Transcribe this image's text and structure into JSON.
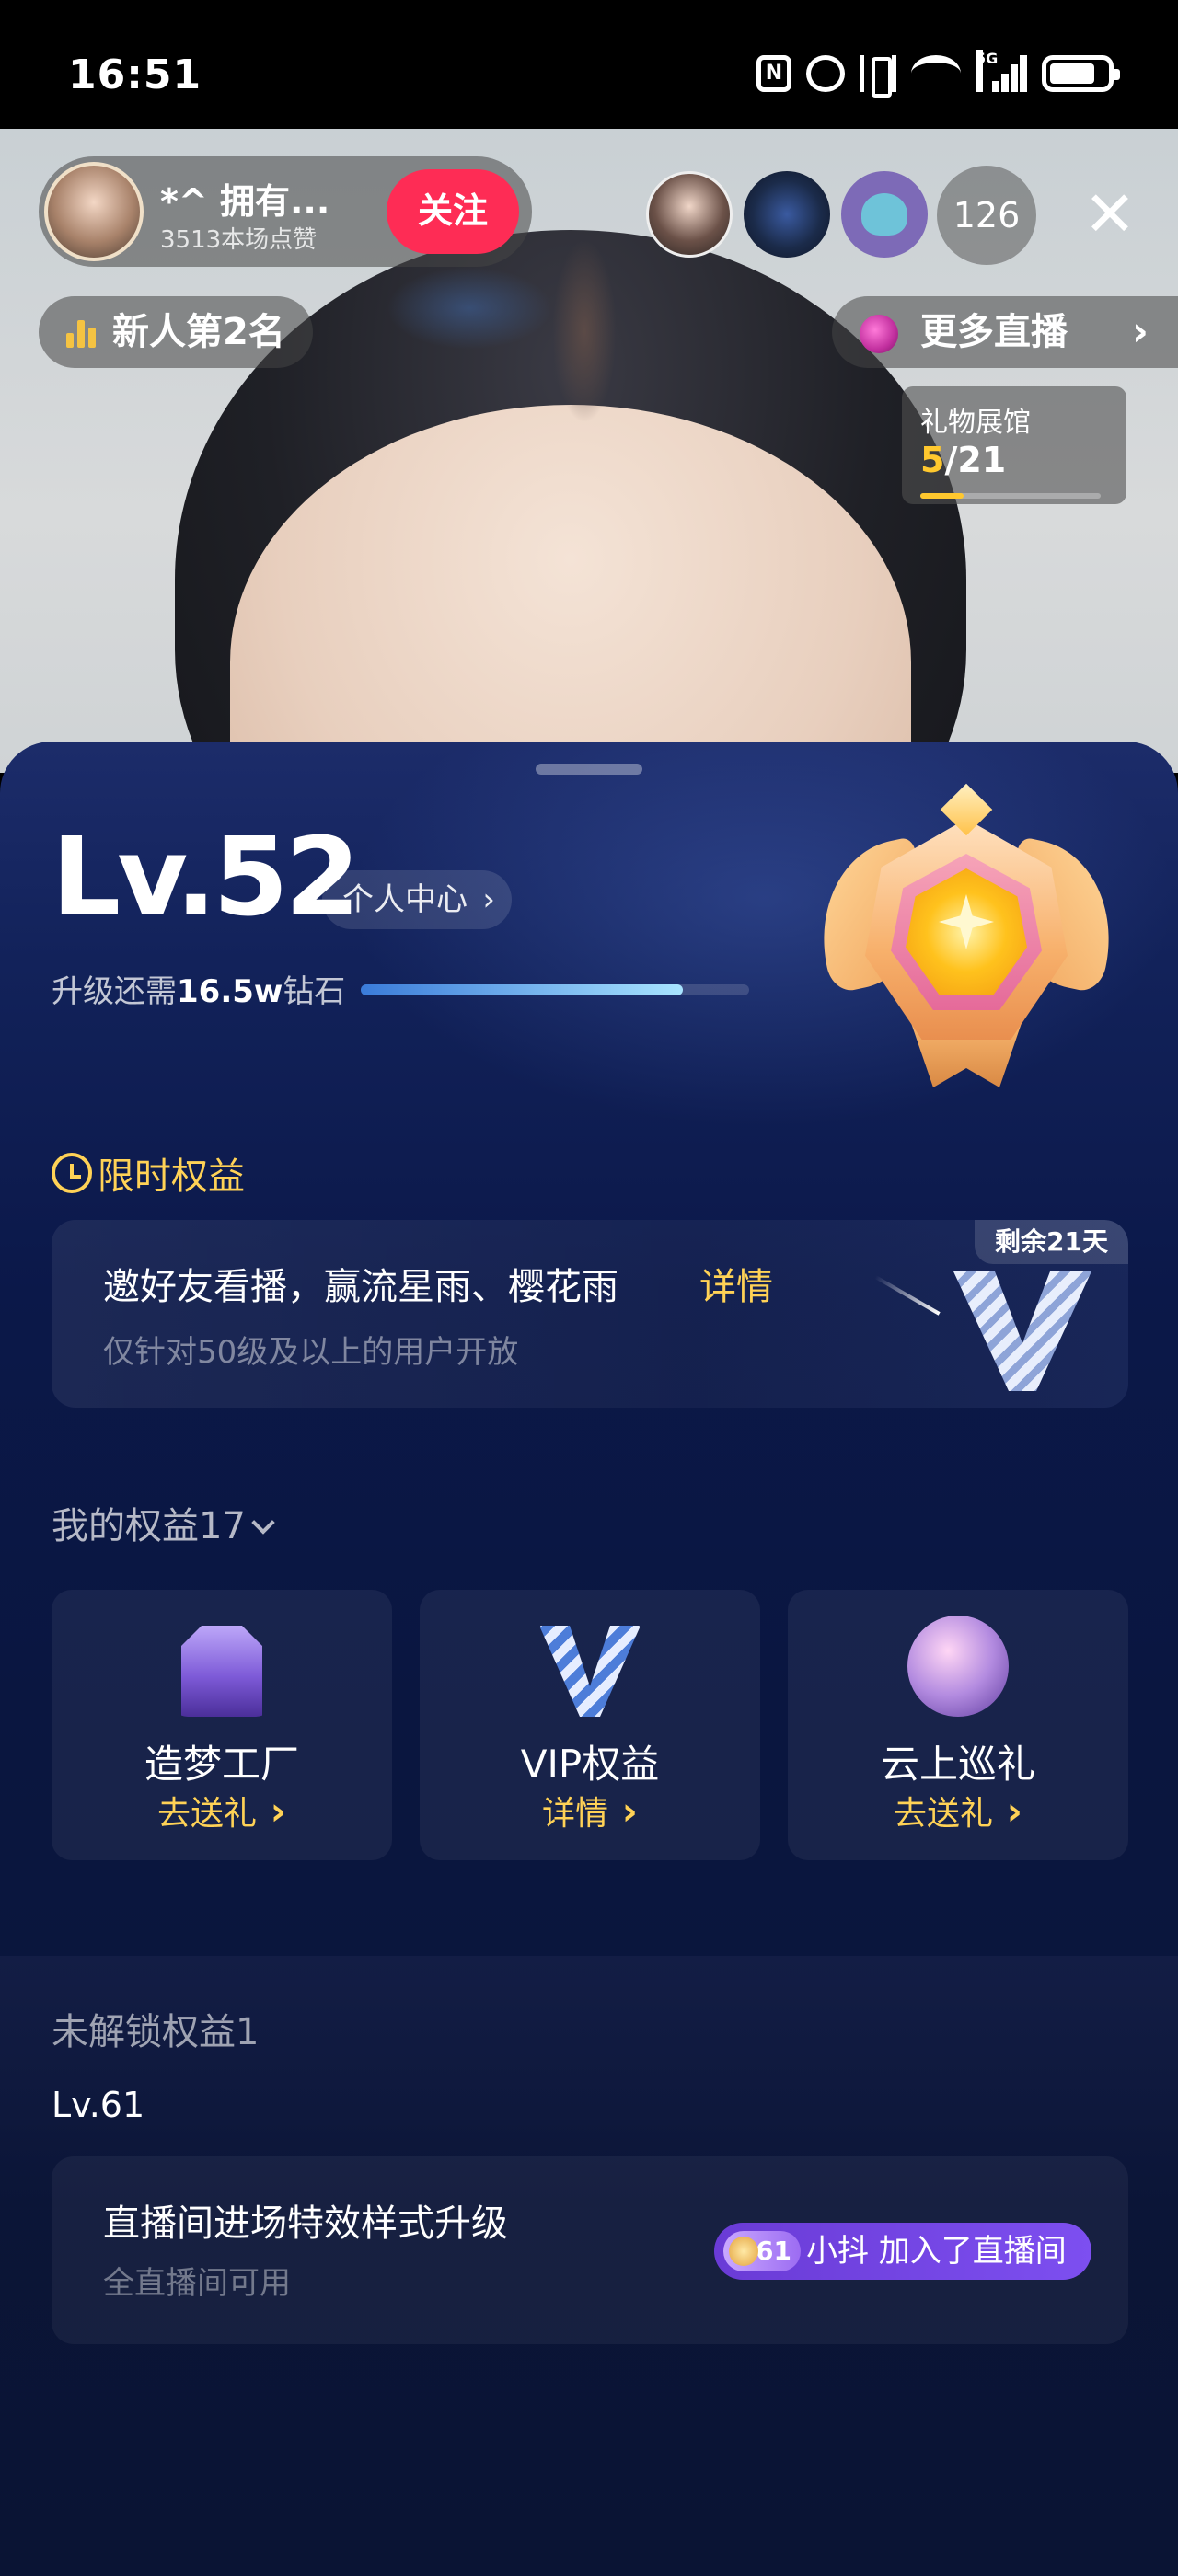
{
  "status_bar": {
    "time": "16:51",
    "network": "5G",
    "icons": [
      "nfc-icon",
      "alarm-icon",
      "vibrate-icon",
      "wifi-icon",
      "signal-icon",
      "battery-icon"
    ]
  },
  "live": {
    "host": {
      "name": "*^ 拥有...",
      "likes": "3513本场点赞",
      "follow_label": "关注"
    },
    "viewer_count": "126",
    "close_label": "✕",
    "rank_label": "新人第2名",
    "more_live_label": "更多直播",
    "more_live_chevron": "›",
    "gift_hall": {
      "title": "礼物展馆",
      "current": "5",
      "total": "/21",
      "progress_fraction": 0.238
    }
  },
  "level_panel": {
    "level": "Lv.52",
    "personal_center": "个人中心",
    "personal_center_chevron": "›",
    "upgrade_prefix": "升级还需",
    "upgrade_amount": "16.5w",
    "upgrade_suffix": "钻石",
    "progress_fraction": 0.83,
    "limited_title": "限时权益",
    "promo": {
      "title": "邀好友看播，赢流星雨、樱花雨",
      "detail": "详情",
      "subtitle": "仅针对50级及以上的用户开放",
      "remaining": "剩余21天"
    },
    "my_rights_title": "我的权益17",
    "rights": [
      {
        "name": "造梦工厂",
        "action": "去送礼",
        "icon": "dream-factory-icon"
      },
      {
        "name": "VIP权益",
        "action": "详情",
        "icon": "vip-icon"
      },
      {
        "name": "云上巡礼",
        "action": "去送礼",
        "icon": "cloud-tour-icon"
      }
    ],
    "locked_title": "未解锁权益1",
    "locked_level": "Lv.61",
    "locked_card": {
      "title": "直播间进场特效样式升级",
      "subtitle": "全直播间可用",
      "preview_level": "61",
      "preview_text": "小抖 加入了直播间"
    }
  },
  "colors": {
    "accent_gold": "#ffd256",
    "follow_red": "#fe2c55",
    "sheet_navy": "#0b1849",
    "entry_purple": "#7d4ff0"
  }
}
